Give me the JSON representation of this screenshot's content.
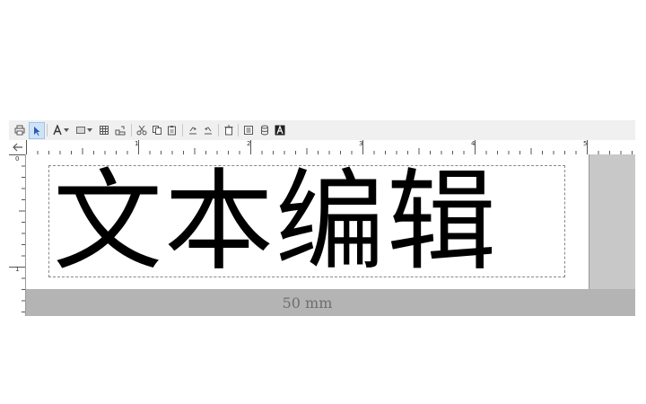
{
  "toolbar": {
    "icons": [
      "print-icon",
      "pointer-icon",
      "text-tool-icon",
      "rectangle-tool-icon",
      "table-tool-icon",
      "image-tool-icon",
      "cut-icon",
      "copy-icon",
      "paste-icon",
      "undo-icon",
      "redo-icon",
      "delete-icon",
      "properties-icon",
      "database-icon",
      "font-icon"
    ]
  },
  "ruler": {
    "horizontal_labels": [
      "1",
      "2",
      "3",
      "4",
      "5"
    ],
    "vertical_labels": [
      "0",
      "1"
    ]
  },
  "label": {
    "text": "文本编辑",
    "width_label": "50 mm"
  },
  "colors": {
    "toolbar_bg": "#f0f0f0",
    "canvas_bg": "#c8c8c8",
    "strip_bg": "#b4b4b4",
    "active_tool": "#cfe3f7"
  }
}
